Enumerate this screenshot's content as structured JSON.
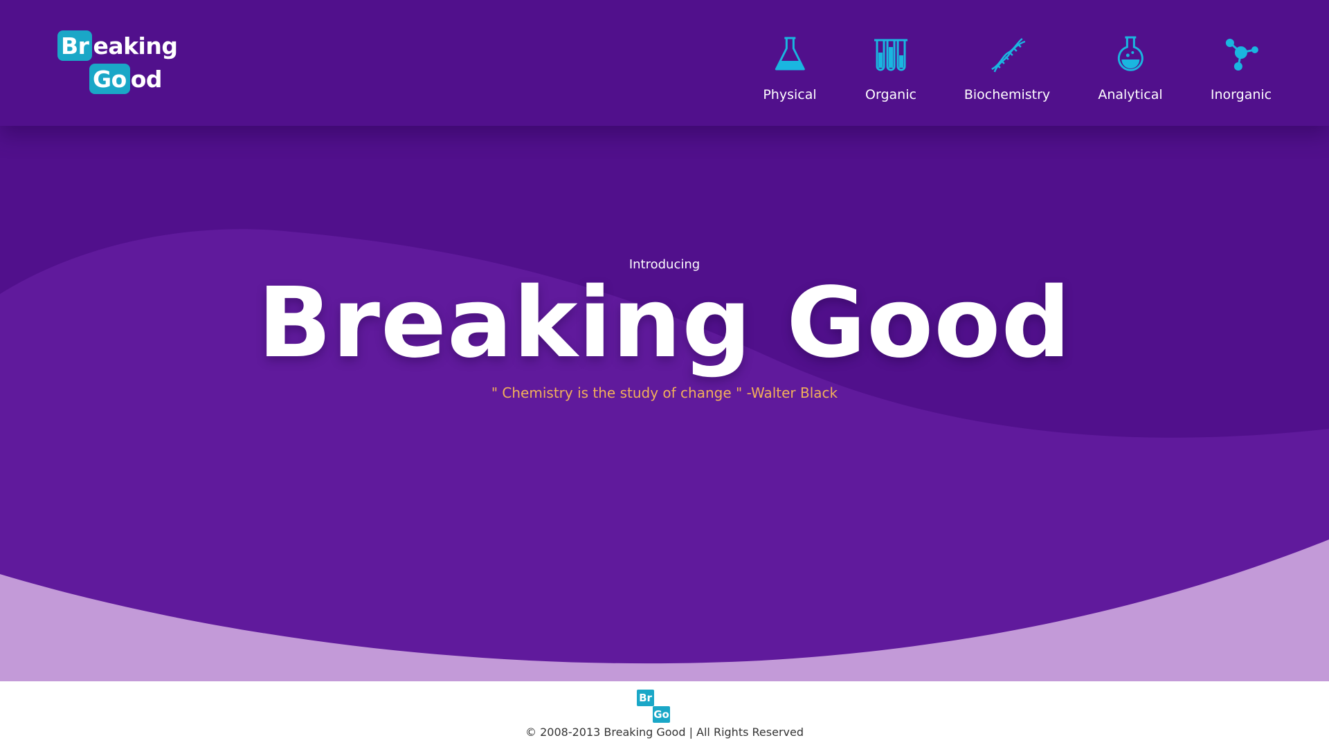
{
  "header": {
    "logo": {
      "line1_symbol": "Br",
      "line1_rest": "eaking",
      "line2_symbol": "Go",
      "line2_rest": "od"
    },
    "nav": [
      {
        "label": "Physical",
        "icon": "flask-icon"
      },
      {
        "label": "Organic",
        "icon": "test-tubes-icon"
      },
      {
        "label": "Biochemistry",
        "icon": "dna-icon"
      },
      {
        "label": "Analytical",
        "icon": "round-flask-icon"
      },
      {
        "label": "Inorganic",
        "icon": "molecule-icon"
      }
    ]
  },
  "hero": {
    "intro": "Introducing",
    "title": "Breaking Good",
    "quote": "\" Chemistry is the study of change \" -Walter Black"
  },
  "footer": {
    "logo_symbol_1": "Br",
    "logo_symbol_2": "Go",
    "copyright": "© 2008-2013 Breaking Good | All Rights Reserved"
  },
  "colors": {
    "primary_purple": "#51108c",
    "wave_purple": "#601a9c",
    "light_wave": "#c39ad8",
    "accent_cyan": "#1aa7c7",
    "quote_orange": "#f2b05a"
  }
}
